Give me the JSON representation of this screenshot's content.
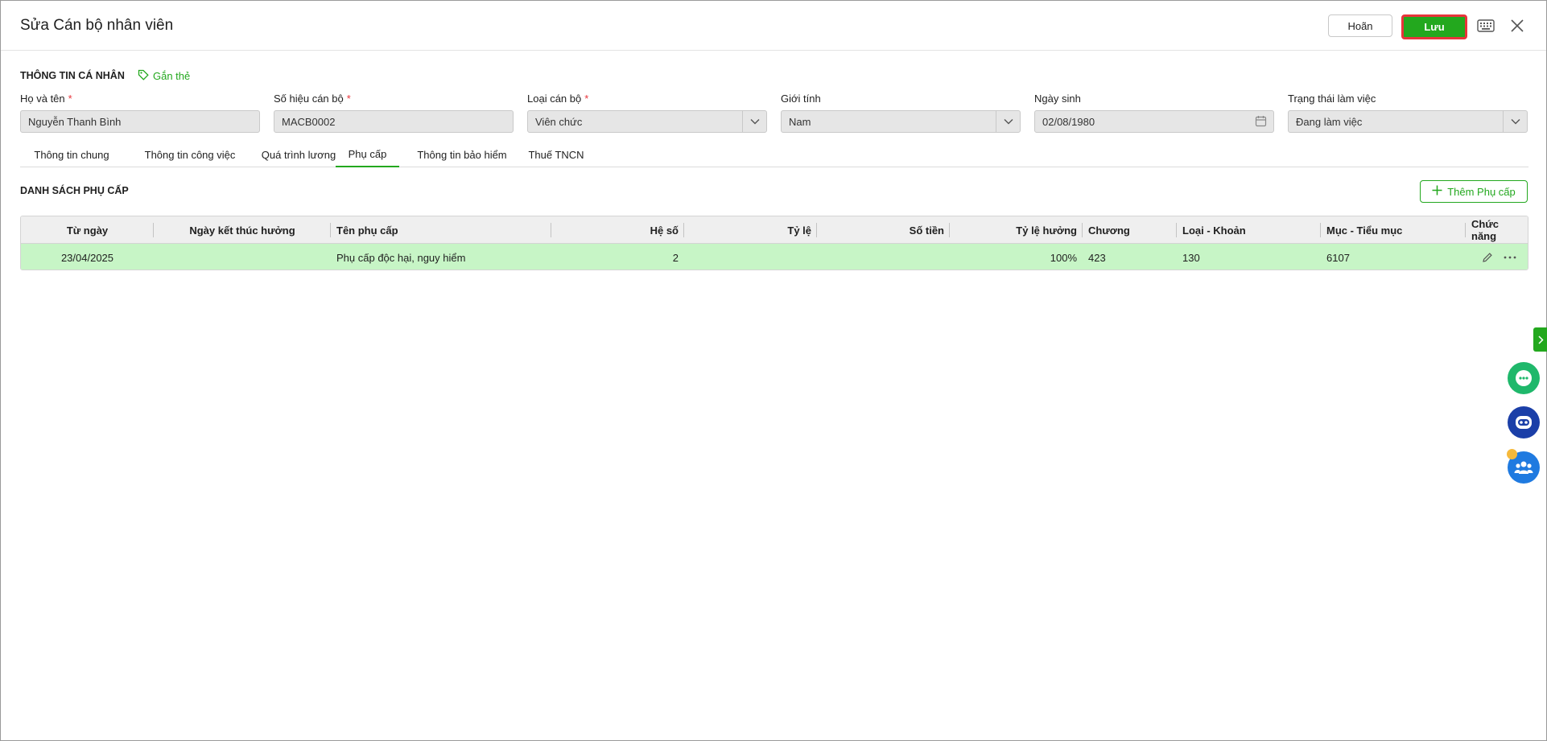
{
  "header": {
    "title": "Sửa Cán bộ nhân viên",
    "cancel_label": "Hoãn",
    "save_label": "Lưu"
  },
  "personal": {
    "section_title": "THÔNG TIN CÁ NHÂN",
    "tag_label": "Gắn thẻ",
    "fields": [
      {
        "label": "Họ và tên",
        "required": "*",
        "value": "Nguyễn Thanh Bình"
      },
      {
        "label": "Số hiệu cán bộ",
        "required": "*",
        "value": "MACB0002"
      },
      {
        "label": "Loại cán bộ",
        "required": "*",
        "value": "Viên chức"
      },
      {
        "label": "Giới tính",
        "value": "Nam"
      },
      {
        "label": "Ngày sinh",
        "value": "02/08/1980"
      },
      {
        "label": "Trạng thái làm việc",
        "value": "Đang làm việc"
      }
    ]
  },
  "tabs": [
    {
      "label": "Thông tin chung"
    },
    {
      "label": "Thông tin công việc"
    },
    {
      "label": "Quá trình lương"
    },
    {
      "label": "Phụ cấp",
      "active": true
    },
    {
      "label": "Thông tin bảo hiểm"
    },
    {
      "label": "Thuế TNCN"
    }
  ],
  "allowance": {
    "section_title": "DANH SÁCH PHỤ CẤP",
    "add_label": "Thêm Phụ cấp",
    "columns": [
      "Từ ngày",
      "Ngày kết thúc hưởng",
      "Tên phụ cấp",
      "Hệ số",
      "Tỷ lệ",
      "Số tiền",
      "Tỷ lệ hưởng",
      "Chương",
      "Loại - Khoản",
      "Mục - Tiểu mục",
      "Chức năng"
    ],
    "rows": [
      [
        "23/04/2025",
        "",
        "Phụ cấp độc hại, nguy hiểm",
        "2",
        "",
        "",
        "100%",
        "423",
        "130",
        "6107"
      ]
    ]
  },
  "colors": {
    "accent": "#23a81e",
    "selected_row": "#c7f5c6",
    "required": "#e8343b"
  },
  "icons": [
    "keyboard-icon",
    "close-icon",
    "tag-icon",
    "chevron-down-icon",
    "calendar-icon",
    "plus-icon",
    "pencil-icon",
    "more-icon",
    "chevron-right-icon",
    "chat-icon",
    "robot-icon",
    "community-icon"
  ]
}
